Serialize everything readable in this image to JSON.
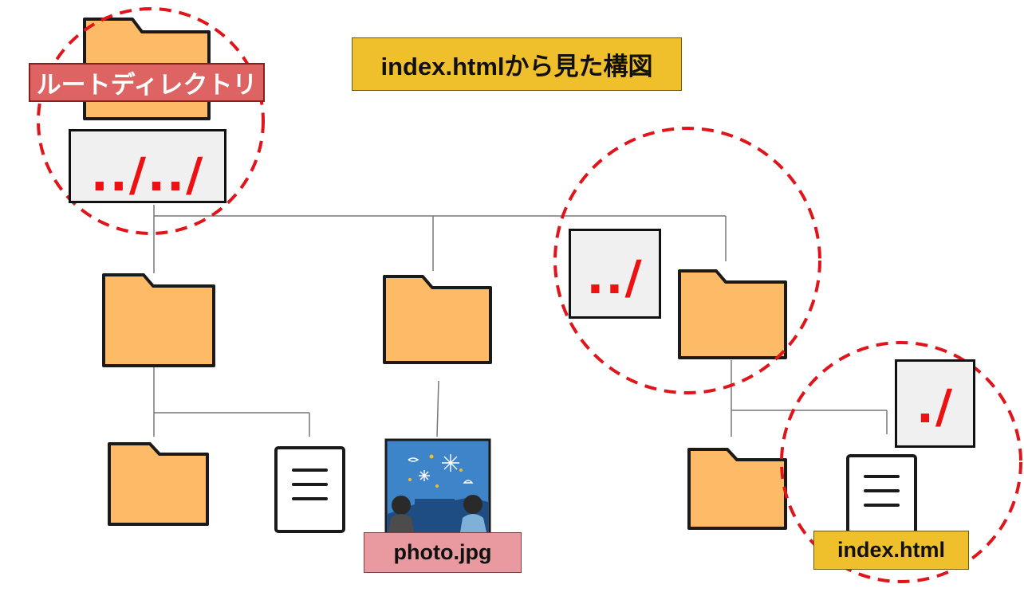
{
  "title": "index.htmlから見た構図",
  "root_label": "ルートディレクトリ",
  "photo_label": "photo.jpg",
  "index_label": "index.html",
  "paths": {
    "root": "../../",
    "parent": "../",
    "current": "./"
  },
  "colors": {
    "folder_fill": "#fdbb68",
    "folder_stroke": "#1a1a1a",
    "highlight_circle": "#e0141b",
    "path_text": "#ee1111",
    "path_box_fill": "#f0f0f0",
    "title_bg": "#f0c02c",
    "root_label_bg": "#de6464",
    "photo_label_bg": "#e99aa0",
    "index_label_bg": "#f0c02c",
    "connector": "#777777"
  },
  "icons": [
    "folder-icon",
    "document-icon",
    "photo-thumbnail"
  ]
}
